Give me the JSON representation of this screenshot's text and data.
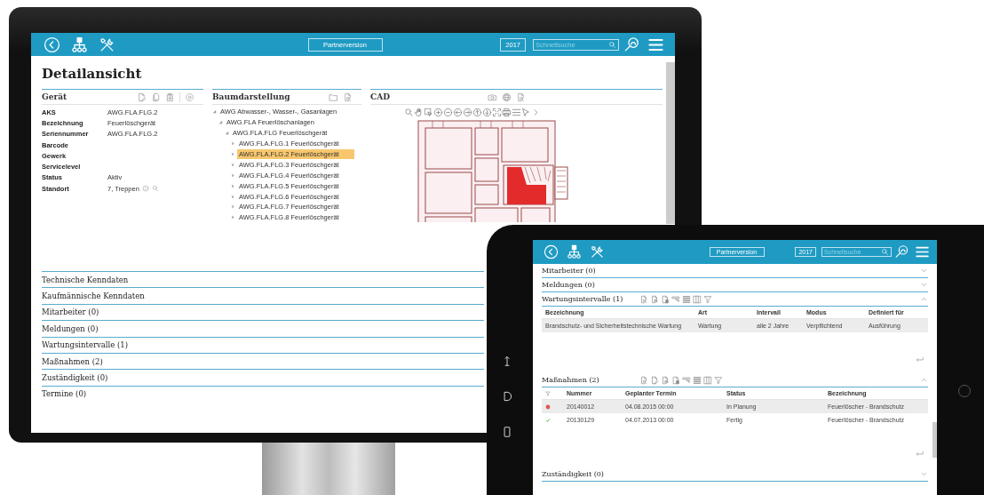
{
  "monitor": {
    "header": {
      "edition": "Partnerversion",
      "year": "2017",
      "search_placeholder": "Schnellsuche"
    },
    "title": "Detailansicht",
    "device_panel": {
      "title": "Gerät",
      "fields": [
        {
          "label": "AKS",
          "value": "AWG.FLA.FLG.2",
          "kind": "plain"
        },
        {
          "label": "Bezeichnung",
          "value": "Feuerlöschgerät",
          "kind": "plain"
        },
        {
          "label": "Seriennummer",
          "value": "AWG.FLA.FLG.2",
          "kind": "plain"
        },
        {
          "label": "Barcode",
          "kind": "plain"
        },
        {
          "label": "Gewerk",
          "kind": "plain"
        },
        {
          "label": "Servicelevel",
          "kind": "plain"
        },
        {
          "label": "Status",
          "value": "Aktiv",
          "kind": "plain"
        },
        {
          "label": "Standort",
          "value": "7, Treppen",
          "kind": "lookup"
        }
      ]
    },
    "tree_panel": {
      "title": "Baumdarstellung",
      "items": [
        {
          "label": "AWG Abwasser-, Wasser-, Gasanlagen",
          "expanded": true,
          "selected": false,
          "children": [
            {
              "label": "AWG.FLA Feuerlöschanlagen",
              "expanded": true,
              "selected": false,
              "children": [
                {
                  "label": "AWG.FLA.FLG Feuerlöschgerät",
                  "expanded": true,
                  "selected": false,
                  "children": [
                    {
                      "label": "AWG.FLA.FLG.1 Feuerlöschgerät",
                      "expanded": false,
                      "selected": false
                    },
                    {
                      "label": "AWG.FLA.FLG.2 Feuerlöschgerät",
                      "expanded": false,
                      "selected": true
                    },
                    {
                      "label": "AWG.FLA.FLG.3 Feuerlöschgerät",
                      "expanded": false,
                      "selected": false
                    },
                    {
                      "label": "AWG.FLA.FLG.4 Feuerlöschgerät",
                      "expanded": false,
                      "selected": false
                    },
                    {
                      "label": "AWG.FLA.FLG.5 Feuerlöschgerät",
                      "expanded": false,
                      "selected": false
                    },
                    {
                      "label": "AWG.FLA.FLG.6 Feuerlöschgerät",
                      "expanded": false,
                      "selected": false
                    },
                    {
                      "label": "AWG.FLA.FLG.7 Feuerlöschgerät",
                      "expanded": false,
                      "selected": false
                    },
                    {
                      "label": "AWG.FLA.FLG.8 Feuerlöschgerät",
                      "expanded": false,
                      "selected": false
                    }
                  ]
                }
              ]
            }
          ]
        }
      ]
    },
    "cad_panel": {
      "title": "CAD"
    },
    "sections": [
      "Technische Kenndaten",
      "Kaufmännische Kenndaten",
      "Mitarbeiter (0)",
      "Meldungen (0)",
      "Wartungsintervalle (1)",
      "Maßnahmen (2)",
      "Zuständigkeit (0)",
      "Termine (0)"
    ]
  },
  "tablet": {
    "header": {
      "edition": "Partnerversion",
      "year": "2017",
      "search_placeholder": "Schnellsuche"
    },
    "sections": [
      {
        "title": "Mitarbeiter (0)",
        "expanded": false
      },
      {
        "title": "Meldungen (0)",
        "expanded": false
      },
      {
        "title": "Wartungsintervalle (1)",
        "expanded": true,
        "table": {
          "columns": [
            {
              "label": "Bezeichnung",
              "kind": "text"
            },
            {
              "label": "Art",
              "kind": "text"
            },
            {
              "label": "Intervall",
              "kind": "text"
            },
            {
              "label": "Modus",
              "kind": "text"
            },
            {
              "label": "Definiert für",
              "kind": "text"
            }
          ],
          "rows": [
            {
              "cells": [
                "Brandschutz- und Sicherheitstechnische Wartung",
                "Wartung",
                "alle 2 Jahre",
                "Verpflichtend",
                "Ausführung"
              ]
            }
          ]
        }
      },
      {
        "title": "Maßnahmen (2)",
        "expanded": true,
        "table": {
          "columns": [
            {
              "label": "Nummer",
              "kind": "text"
            },
            {
              "label": "Geplanter Termin",
              "kind": "text"
            },
            {
              "label": "Status",
              "kind": "text"
            },
            {
              "label": "Bezeichnung",
              "kind": "text"
            }
          ],
          "rows": [
            {
              "done": false,
              "cells": [
                "20140012",
                "04.08.2015 00:00",
                "In Planung",
                "Feuerlöscher - Brandschutz"
              ]
            },
            {
              "done": true,
              "cells": [
                "20130129",
                "04.07.2013 00:00",
                "Fertig",
                "Feuerlöscher - Brandschutz"
              ]
            }
          ]
        }
      },
      {
        "title": "Zuständigkeit (0)",
        "expanded": false
      }
    ]
  }
}
